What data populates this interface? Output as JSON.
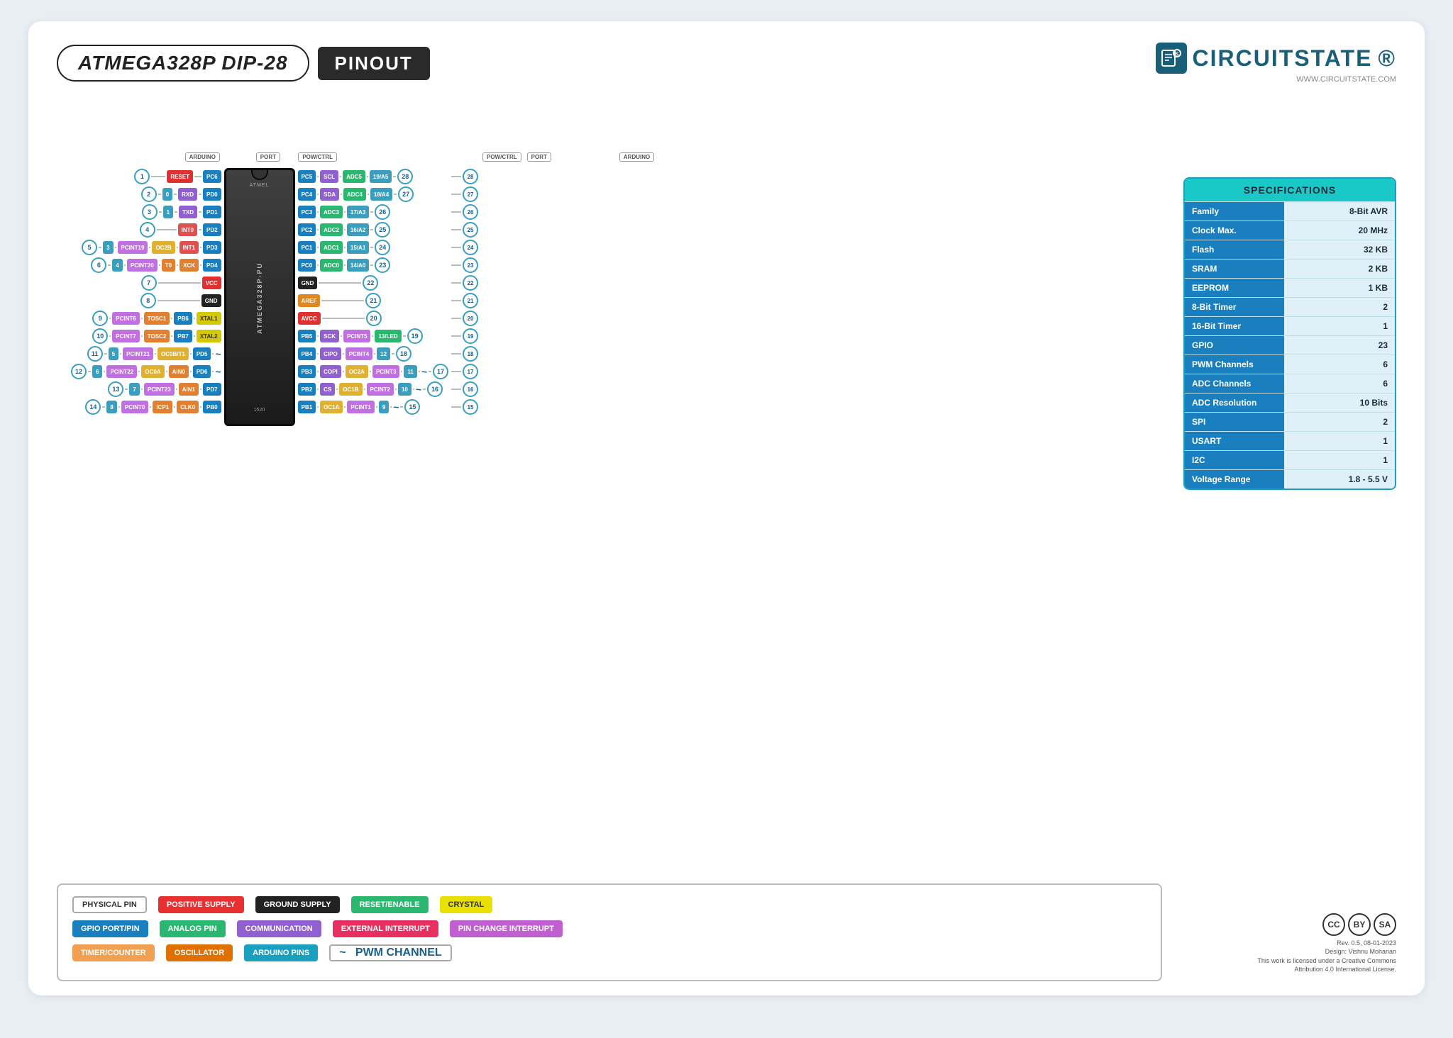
{
  "page": {
    "title": "ATMEGA328P DIP-28 PINOUT",
    "title_italic": "ATMEGA328P DIP-28",
    "pinout_label": "PINOUT",
    "logo_text": "CIRCUITSTATE",
    "logo_url": "WWW.CIRCUITSTATE.COM"
  },
  "specs": {
    "header": "SPECIFICATIONS",
    "rows": [
      {
        "label": "Family",
        "value": "8-Bit AVR"
      },
      {
        "label": "Clock Max.",
        "value": "20 MHz"
      },
      {
        "label": "Flash",
        "value": "32 KB"
      },
      {
        "label": "SRAM",
        "value": "2 KB"
      },
      {
        "label": "EEPROM",
        "value": "1 KB"
      },
      {
        "label": "8-Bit Timer",
        "value": "2"
      },
      {
        "label": "16-Bit Timer",
        "value": "1"
      },
      {
        "label": "GPIO",
        "value": "23"
      },
      {
        "label": "PWM Channels",
        "value": "6"
      },
      {
        "label": "ADC Channels",
        "value": "6"
      },
      {
        "label": "ADC Resolution",
        "value": "10 Bits"
      },
      {
        "label": "SPI",
        "value": "2"
      },
      {
        "label": "USART",
        "value": "1"
      },
      {
        "label": "I2C",
        "value": "1"
      },
      {
        "label": "Voltage Range",
        "value": "1.8 - 5.5 V"
      }
    ]
  },
  "legend": {
    "items": [
      {
        "label": "PHYSICAL PIN",
        "class": "l-physical"
      },
      {
        "label": "POSITIVE SUPPLY",
        "class": "l-positive"
      },
      {
        "label": "GROUND SUPPLY",
        "class": "l-ground"
      },
      {
        "label": "RESET/ENABLE",
        "class": "l-reset"
      },
      {
        "label": "CRYSTAL",
        "class": "l-crystal"
      },
      {
        "label": "GPIO PORT/PIN",
        "class": "l-gpio"
      },
      {
        "label": "ANALOG PIN",
        "class": "l-analog"
      },
      {
        "label": "COMMUNICATION",
        "class": "l-comm"
      },
      {
        "label": "EXTERNAL INTERRUPT",
        "class": "l-extint"
      },
      {
        "label": "PIN CHANGE INTERRUPT",
        "class": "l-pinchange"
      },
      {
        "label": "TIMER/COUNTER",
        "class": "l-timer"
      },
      {
        "label": "OSCILLATOR",
        "class": "l-oscillator"
      },
      {
        "label": "ARDUINO PINS",
        "class": "l-arduino"
      },
      {
        "label": "~ PWM CHANNEL",
        "class": "l-pwm"
      }
    ]
  },
  "cc": {
    "rev": "Rev. 0.5, 08-01-2023",
    "design": "Design: Vishnu Mohanan",
    "license1": "This work is licensed under a Creative Commons",
    "license2": "Attribution 4.0 International License."
  },
  "chip": {
    "mfg": "ATMEL",
    "model": "ATMEGA328P-PU",
    "code": "1520"
  }
}
